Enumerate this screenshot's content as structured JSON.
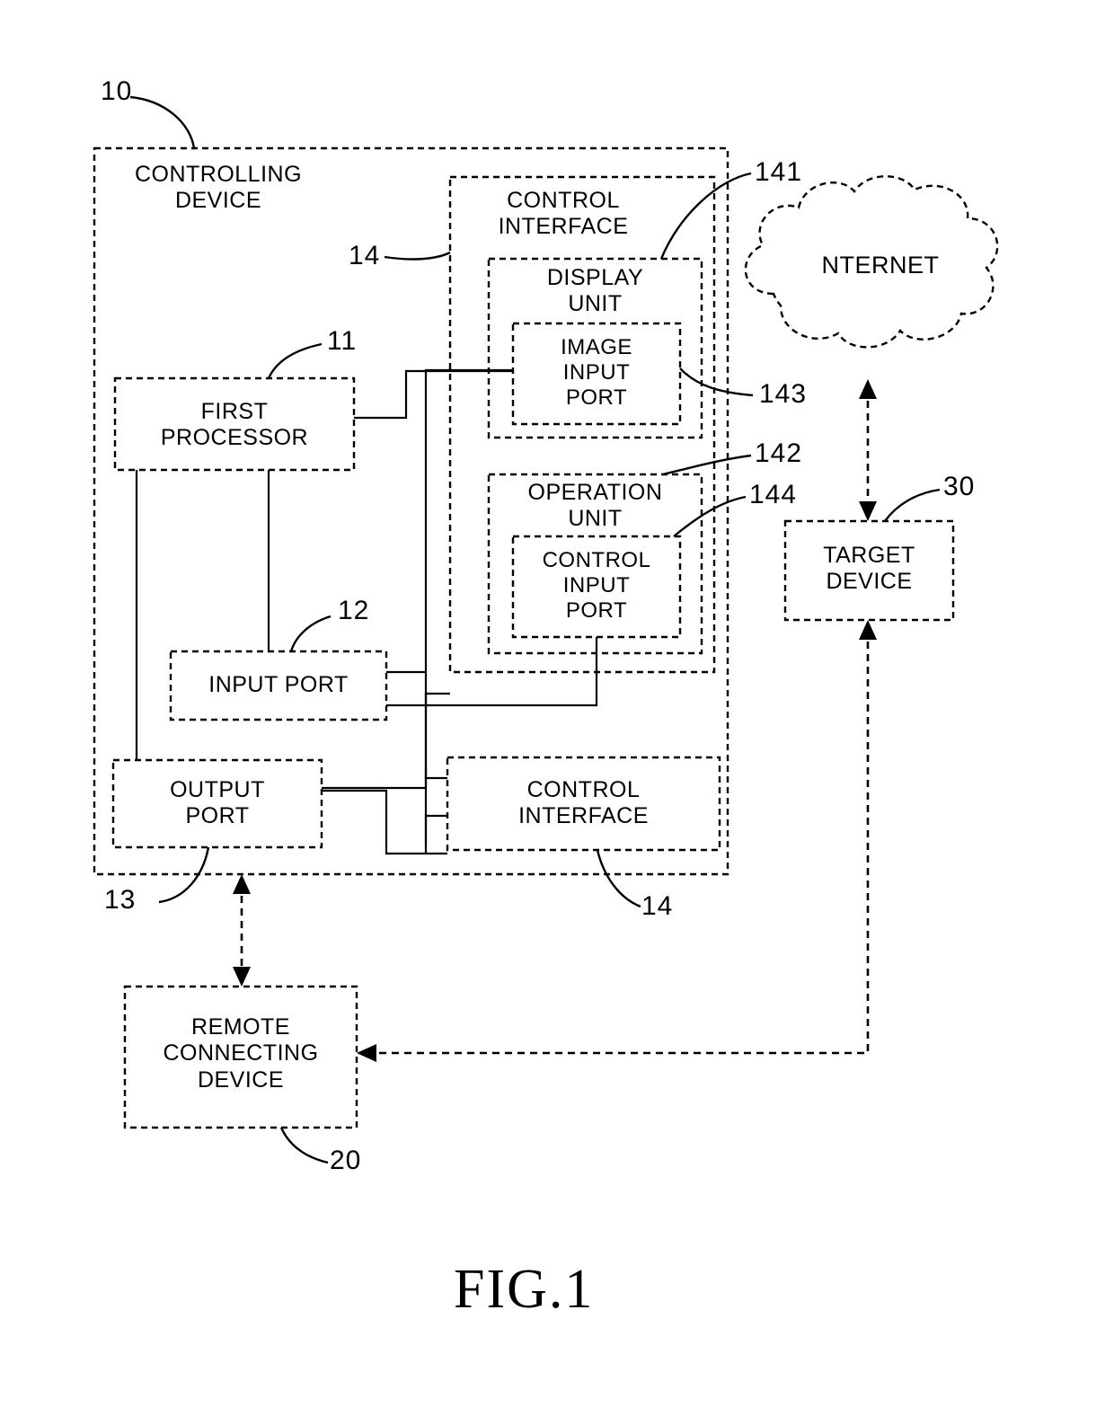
{
  "figure": {
    "caption": "FIG.1",
    "type": "patent-block-diagram"
  },
  "blocks": {
    "controlling_device": {
      "label": "CONTROLLING\nDEVICE",
      "ref": "10"
    },
    "first_processor": {
      "label": "FIRST\nPROCESSOR",
      "ref": "11"
    },
    "input_port": {
      "label": "INPUT  PORT",
      "ref": "12"
    },
    "output_port": {
      "label": "OUTPUT\nPORT",
      "ref": "13"
    },
    "control_interface_main": {
      "label": "CONTROL\nINTERFACE",
      "ref": "14"
    },
    "control_interface_lower": {
      "label": "CONTROL\nINTERFACE",
      "ref": "14"
    },
    "display_unit": {
      "label": "DISPLAY\nUNIT",
      "ref": "141"
    },
    "image_input_port": {
      "label": "IMAGE\nINPUT\nPORT",
      "ref": "143"
    },
    "operation_unit": {
      "label": "OPERATION\nUNIT",
      "ref": "142"
    },
    "control_input_port": {
      "label": "CONTROL\nINPUT\nPORT",
      "ref": "144"
    },
    "internet_cloud": {
      "label": "NTERNET"
    },
    "target_device": {
      "label": "TARGET\nDEVICE",
      "ref": "30"
    },
    "remote_connecting_device": {
      "label": "REMOTE\nCONNECTING\nDEVICE",
      "ref": "20"
    }
  },
  "reference_numerals": {
    "n10": "10",
    "n11": "11",
    "n12": "12",
    "n13": "13",
    "n14_top": "14",
    "n14_bottom": "14",
    "n141": "141",
    "n142": "142",
    "n143": "143",
    "n144": "144",
    "n20": "20",
    "n30": "30"
  },
  "colors": {
    "ink": "#000000",
    "paper": "#ffffff"
  }
}
